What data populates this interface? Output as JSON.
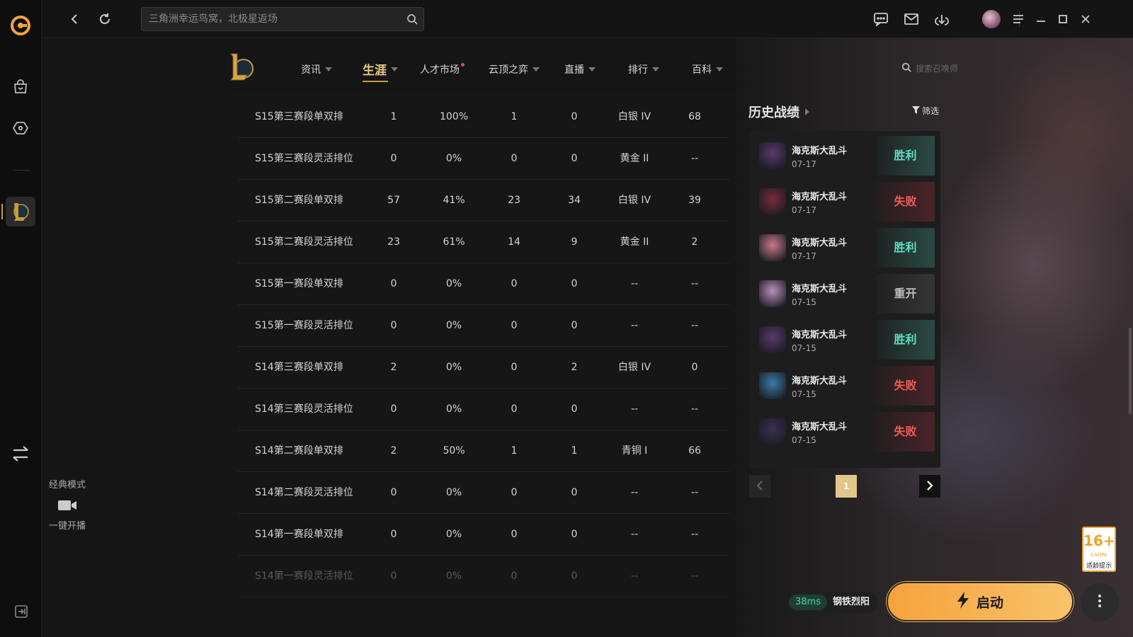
{
  "topbar": {
    "search_placeholder": "三角洲幸运鸟窝，北极星返场"
  },
  "rail": {
    "classic_mode_label": "经典模式",
    "live_label": "一键开播"
  },
  "nav": {
    "items": [
      {
        "label": "资讯",
        "dropdown": true
      },
      {
        "label": "生涯",
        "dropdown": true,
        "active": true
      },
      {
        "label": "人才市场",
        "badge_dot": true
      },
      {
        "label": "云顶之弈",
        "dropdown": true
      },
      {
        "label": "直播",
        "dropdown": true
      },
      {
        "label": "排行",
        "dropdown": true
      },
      {
        "label": "百科",
        "dropdown": true
      }
    ],
    "summoner_search_placeholder": "搜索召唤师"
  },
  "table": {
    "rows": [
      {
        "name": "S15第三赛段单双排",
        "games": "1",
        "rate": "100%",
        "wins": "1",
        "losses": "0",
        "tier": "白银 IV",
        "lp": "68"
      },
      {
        "name": "S15第三赛段灵活排位",
        "games": "0",
        "rate": "0%",
        "wins": "0",
        "losses": "0",
        "tier": "黄金 II",
        "lp": "--"
      },
      {
        "name": "S15第二赛段单双排",
        "games": "57",
        "rate": "41%",
        "wins": "23",
        "losses": "34",
        "tier": "白银 IV",
        "lp": "39"
      },
      {
        "name": "S15第二赛段灵活排位",
        "games": "23",
        "rate": "61%",
        "wins": "14",
        "losses": "9",
        "tier": "黄金 II",
        "lp": "2"
      },
      {
        "name": "S15第一赛段单双排",
        "games": "0",
        "rate": "0%",
        "wins": "0",
        "losses": "0",
        "tier": "--",
        "lp": "--"
      },
      {
        "name": "S15第一赛段灵活排位",
        "games": "0",
        "rate": "0%",
        "wins": "0",
        "losses": "0",
        "tier": "--",
        "lp": "--"
      },
      {
        "name": "S14第三赛段单双排",
        "games": "2",
        "rate": "0%",
        "wins": "0",
        "losses": "2",
        "tier": "白银 IV",
        "lp": "0"
      },
      {
        "name": "S14第三赛段灵活排位",
        "games": "0",
        "rate": "0%",
        "wins": "0",
        "losses": "0",
        "tier": "--",
        "lp": "--"
      },
      {
        "name": "S14第二赛段单双排",
        "games": "2",
        "rate": "50%",
        "wins": "1",
        "losses": "1",
        "tier": "青铜 I",
        "lp": "66"
      },
      {
        "name": "S14第二赛段灵活排位",
        "games": "0",
        "rate": "0%",
        "wins": "0",
        "losses": "0",
        "tier": "--",
        "lp": "--"
      },
      {
        "name": "S14第一赛段单双排",
        "games": "0",
        "rate": "0%",
        "wins": "0",
        "losses": "0",
        "tier": "--",
        "lp": "--"
      },
      {
        "name": "S14第一赛段灵活排位",
        "games": "0",
        "rate": "0%",
        "wins": "0",
        "losses": "0",
        "tier": "--",
        "lp": "--"
      }
    ]
  },
  "history": {
    "title": "历史战绩",
    "filter_label": "筛选",
    "matches": [
      {
        "mode": "海克斯大乱斗",
        "date": "07-17",
        "result": "胜利",
        "outcome": "win",
        "champ_color": "#5a3a6a"
      },
      {
        "mode": "海克斯大乱斗",
        "date": "07-17",
        "result": "失败",
        "outcome": "lose",
        "champ_color": "#7a2a3a"
      },
      {
        "mode": "海克斯大乱斗",
        "date": "07-17",
        "result": "胜利",
        "outcome": "win",
        "champ_color": "#c87a8a"
      },
      {
        "mode": "海克斯大乱斗",
        "date": "07-15",
        "result": "重开",
        "outcome": "remake",
        "champ_color": "#b890b8"
      },
      {
        "mode": "海克斯大乱斗",
        "date": "07-15",
        "result": "胜利",
        "outcome": "win",
        "champ_color": "#5a3a6a"
      },
      {
        "mode": "海克斯大乱斗",
        "date": "07-15",
        "result": "失败",
        "outcome": "lose",
        "champ_color": "#3a7aa8"
      },
      {
        "mode": "海克斯大乱斗",
        "date": "07-15",
        "result": "失败",
        "outcome": "lose",
        "champ_color": "#3a3050"
      }
    ],
    "current_page": "1"
  },
  "status": {
    "ping": "38ms",
    "server": "钢铁烈阳",
    "launch_label": "启动"
  },
  "age_rating": {
    "number": "16+",
    "org": "CADPA",
    "hint": "适龄提示"
  }
}
